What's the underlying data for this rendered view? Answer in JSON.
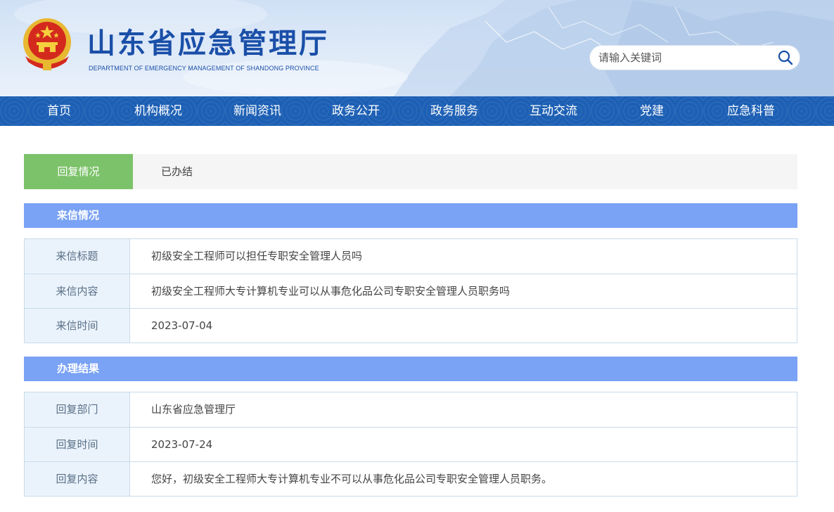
{
  "header": {
    "title": "山东省应急管理厅",
    "subtitle": "DEPARTMENT OF EMERGENCY MANAGEMENT OF SHANDONG PROVINCE",
    "search_placeholder": "请输入关键词"
  },
  "nav": {
    "items": [
      "首页",
      "机构概况",
      "新闻资讯",
      "政务公开",
      "政务服务",
      "互动交流",
      "党建",
      "应急科普"
    ]
  },
  "status": {
    "label": "回复情况",
    "value": "已办结"
  },
  "letter": {
    "heading": "来信情况",
    "rows": [
      {
        "label": "来信标题",
        "value": "初级安全工程师可以担任专职安全管理人员吗"
      },
      {
        "label": "来信内容",
        "value": "初级安全工程师大专计算机专业可以从事危化品公司专职安全管理人员职务吗"
      },
      {
        "label": "来信时间",
        "value": "2023-07-04"
      }
    ]
  },
  "result": {
    "heading": "办理结果",
    "rows": [
      {
        "label": "回复部门",
        "value": "山东省应急管理厅"
      },
      {
        "label": "回复时间",
        "value": "2023-07-24"
      },
      {
        "label": "回复内容",
        "value": "您好，初级安全工程师大专计算机专业不可以从事危化品公司专职安全管理人员职务。"
      }
    ]
  },
  "colors": {
    "nav_bg": "#1c5fb4",
    "status_label_bg": "#7cc26a",
    "section_head_bg": "#7aa2f5",
    "label_cell_bg": "#eaf3fc",
    "title_blue": "#1a4fa8"
  },
  "icons": {
    "emblem": "national-emblem-icon",
    "search": "search-icon"
  }
}
